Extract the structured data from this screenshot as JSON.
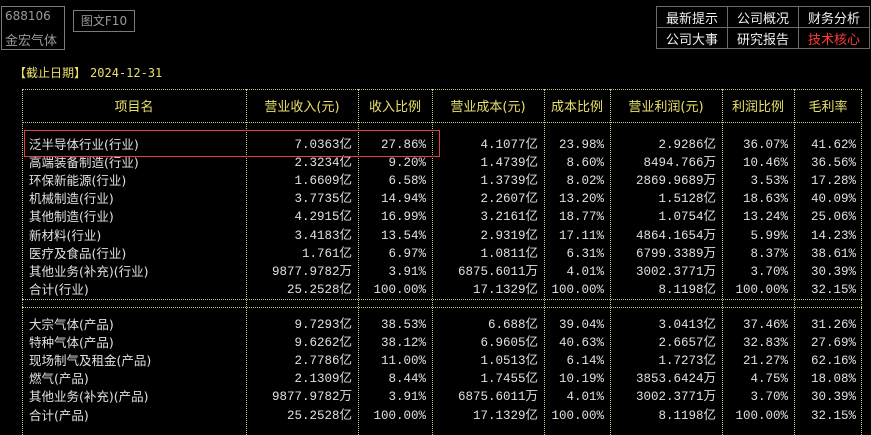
{
  "stock": {
    "code": "688106",
    "name": "金宏气体"
  },
  "tabs": {
    "f10": "图文F10"
  },
  "nav": [
    [
      {
        "label": "最新提示",
        "active": false
      },
      {
        "label": "公司概况",
        "active": false
      },
      {
        "label": "财务分析",
        "active": false
      }
    ],
    [
      {
        "label": "公司大事",
        "active": false
      },
      {
        "label": "研究报告",
        "active": false
      },
      {
        "label": "技术核心",
        "active": true
      }
    ]
  ],
  "colors": {
    "accent": "#e8e06a",
    "active": "#ff3a3a",
    "highlight": "#e04040"
  },
  "deadline": {
    "label": "【截止日期】",
    "value": "2024-12-31"
  },
  "columns": [
    "项目名",
    "营业收入(元)",
    "收入比例",
    "营业成本(元)",
    "成本比例",
    "营业利润(元)",
    "利润比例",
    "毛利率"
  ],
  "industry_rows": [
    [
      "泛半导体行业(行业)",
      "7.0363亿",
      "27.86%",
      "4.1077亿",
      "23.98%",
      "2.9286亿",
      "36.07%",
      "41.62%"
    ],
    [
      "高端装备制造(行业)",
      "2.3234亿",
      "9.20%",
      "1.4739亿",
      "8.60%",
      "8494.766万",
      "10.46%",
      "36.56%"
    ],
    [
      "环保新能源(行业)",
      "1.6609亿",
      "6.58%",
      "1.3739亿",
      "8.02%",
      "2869.9689万",
      "3.53%",
      "17.28%"
    ],
    [
      "机械制造(行业)",
      "3.7735亿",
      "14.94%",
      "2.2607亿",
      "13.20%",
      "1.5128亿",
      "18.63%",
      "40.09%"
    ],
    [
      "其他制造(行业)",
      "4.2915亿",
      "16.99%",
      "3.2161亿",
      "18.77%",
      "1.0754亿",
      "13.24%",
      "25.06%"
    ],
    [
      "新材料(行业)",
      "3.4183亿",
      "13.54%",
      "2.9319亿",
      "17.11%",
      "4864.1654万",
      "5.99%",
      "14.23%"
    ],
    [
      "医疗及食品(行业)",
      "1.761亿",
      "6.97%",
      "1.0811亿",
      "6.31%",
      "6799.3389万",
      "8.37%",
      "38.61%"
    ],
    [
      "其他业务(补充)(行业)",
      "9877.9782万",
      "3.91%",
      "6875.6011万",
      "4.01%",
      "3002.3771万",
      "3.70%",
      "30.39%"
    ],
    [
      "合计(行业)",
      "25.2528亿",
      "100.00%",
      "17.1329亿",
      "100.00%",
      "8.1198亿",
      "100.00%",
      "32.15%"
    ]
  ],
  "product_rows": [
    [
      "大宗气体(产品)",
      "9.7293亿",
      "38.53%",
      "6.688亿",
      "39.04%",
      "3.0413亿",
      "37.46%",
      "31.26%"
    ],
    [
      "特种气体(产品)",
      "9.6262亿",
      "38.12%",
      "6.9605亿",
      "40.63%",
      "2.6657亿",
      "32.83%",
      "27.69%"
    ],
    [
      "现场制气及租金(产品)",
      "2.7786亿",
      "11.00%",
      "1.0513亿",
      "6.14%",
      "1.7273亿",
      "21.27%",
      "62.16%"
    ],
    [
      "燃气(产品)",
      "2.1309亿",
      "8.44%",
      "1.7455亿",
      "10.19%",
      "3853.6424万",
      "4.75%",
      "18.08%"
    ],
    [
      "其他业务(补充)(产品)",
      "9877.9782万",
      "3.91%",
      "6875.6011万",
      "4.01%",
      "3002.3771万",
      "3.70%",
      "30.39%"
    ],
    [
      "合计(产品)",
      "25.2528亿",
      "100.00%",
      "17.1329亿",
      "100.00%",
      "8.1198亿",
      "100.00%",
      "32.15%"
    ]
  ]
}
